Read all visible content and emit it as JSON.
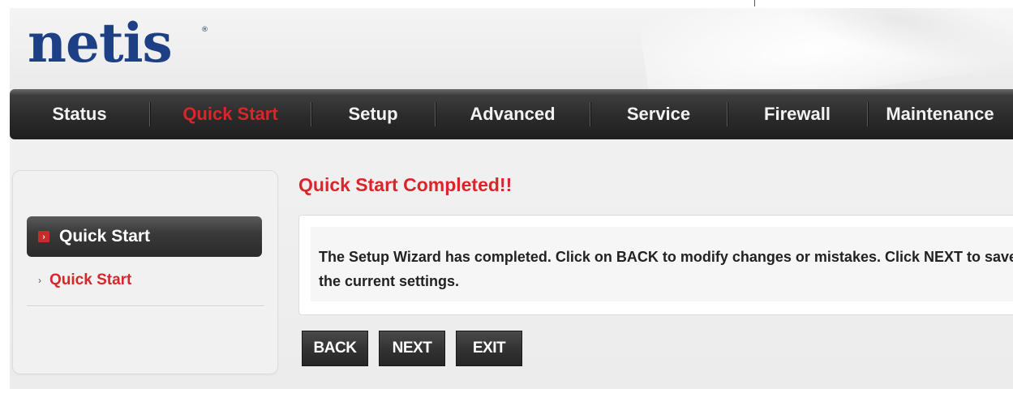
{
  "brand": {
    "logo_text": "netis",
    "registered_mark": "®"
  },
  "nav": {
    "items": [
      {
        "label": "Status",
        "active": false
      },
      {
        "label": "Quick Start",
        "active": true
      },
      {
        "label": "Setup",
        "active": false
      },
      {
        "label": "Advanced",
        "active": false
      },
      {
        "label": "Service",
        "active": false
      },
      {
        "label": "Firewall",
        "active": false
      },
      {
        "label": "Maintenance",
        "active": false
      }
    ]
  },
  "sidebar": {
    "section_label": "Quick Start",
    "section_icon": "chevron-right-icon",
    "items": [
      {
        "label": "Quick Start",
        "active": true,
        "icon": "small-arrow-icon"
      }
    ]
  },
  "main": {
    "title": "Quick Start Completed!!",
    "message": "The Setup Wizard has completed. Click on BACK to modify changes or mistakes. Click NEXT to save the current settings."
  },
  "buttons": {
    "back_label": "BACK",
    "next_label": "NEXT",
    "exit_label": "EXIT"
  },
  "colors": {
    "brand_blue": "#1d3f86",
    "accent_red": "#d8262b",
    "nav_dark": "#2b2b2b"
  }
}
